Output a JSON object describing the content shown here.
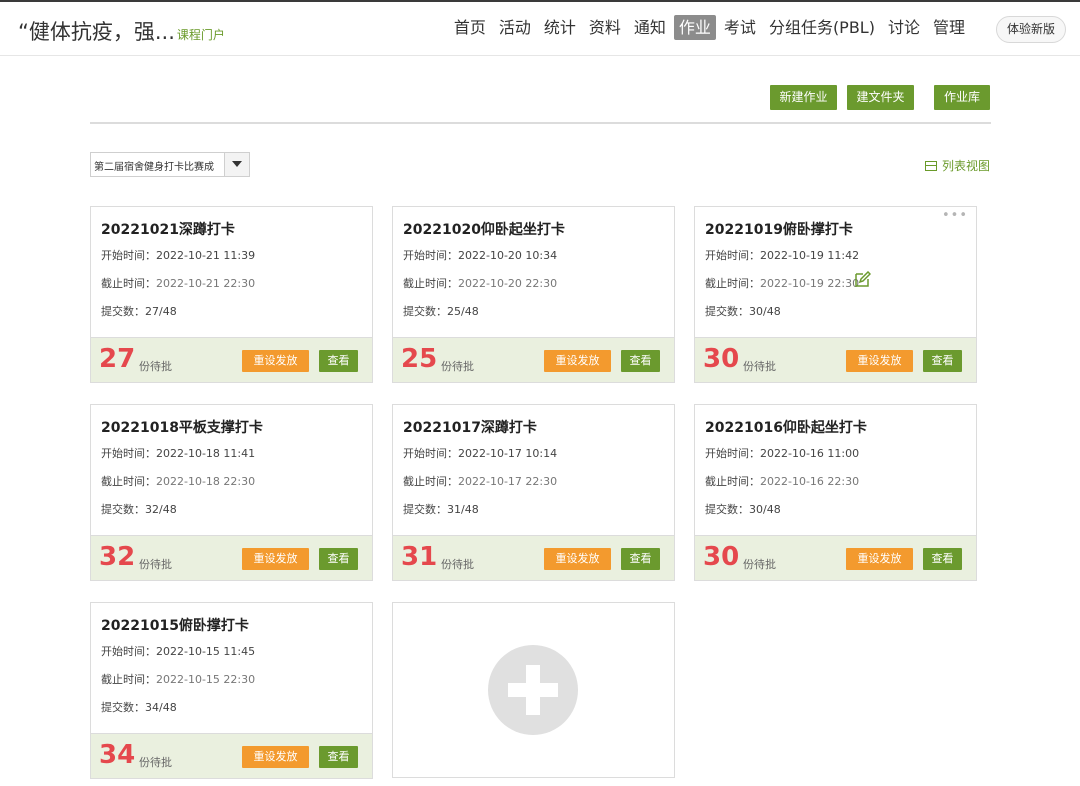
{
  "header": {
    "course_title": "“健体抗疫，强...",
    "portal_link": "课程门户",
    "nav": [
      "首页",
      "活动",
      "统计",
      "资料",
      "通知",
      "作业",
      "考试",
      "分组任务(PBL)",
      "讨论",
      "管理"
    ],
    "active_nav": "作业",
    "new_version_label": "体验新版"
  },
  "toolbar": {
    "new_assignment": "新建作业",
    "new_folder": "建文件夹",
    "library": "作业库"
  },
  "filter": {
    "selected": "第二届宿舍健身打卡比赛成",
    "list_view_label": "列表视图"
  },
  "labels": {
    "start_time": "开始时间：",
    "deadline": "截止时间：",
    "submissions": "提交数：",
    "pending": "份待批",
    "reset_button": "重设发放",
    "view_button": "查看"
  },
  "cards": [
    {
      "title": "20221021深蹲打卡",
      "start": "2022-10-21 11:39",
      "deadline": "2022-10-21 22:30",
      "submissions": "27/48",
      "pending": "27"
    },
    {
      "title": "20221020仰卧起坐打卡",
      "start": "2022-10-20 10:34",
      "deadline": "2022-10-20 22:30",
      "submissions": "25/48",
      "pending": "25"
    },
    {
      "title": "20221019俯卧撑打卡",
      "start": "2022-10-19 11:42",
      "deadline": "2022-10-19 22:30",
      "submissions": "30/48",
      "pending": "30"
    },
    {
      "title": "20221018平板支撑打卡",
      "start": "2022-10-18 11:41",
      "deadline": "2022-10-18 22:30",
      "submissions": "32/48",
      "pending": "32"
    },
    {
      "title": "20221017深蹲打卡",
      "start": "2022-10-17 10:14",
      "deadline": "2022-10-17 22:30",
      "submissions": "31/48",
      "pending": "31"
    },
    {
      "title": "20221016仰卧起坐打卡",
      "start": "2022-10-16 11:00",
      "deadline": "2022-10-16 22:30",
      "submissions": "30/48",
      "pending": "30"
    },
    {
      "title": "20221015俯卧撑打卡",
      "start": "2022-10-15 11:45",
      "deadline": "2022-10-15 22:30",
      "submissions": "34/48",
      "pending": "34"
    }
  ],
  "colors": {
    "accent_green": "#6b9a2e",
    "accent_orange": "#f39a2e",
    "pending_red": "#e5484d",
    "footer_bg": "#eaf0df"
  }
}
